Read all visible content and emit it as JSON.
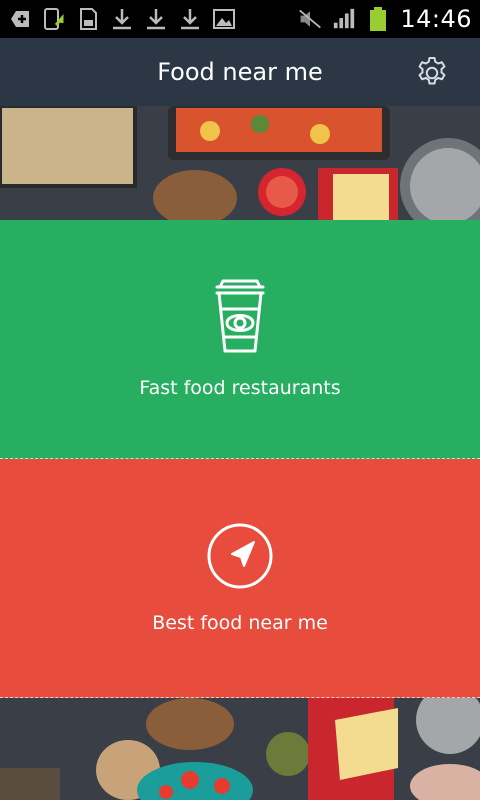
{
  "status_bar": {
    "time": "14:46",
    "icons": [
      "add-icon",
      "phone-update-icon",
      "sd-card-icon",
      "download-icon",
      "download-icon",
      "download-icon",
      "image-icon",
      "mute-icon",
      "signal-icon",
      "battery-icon"
    ]
  },
  "app_bar": {
    "title": "Food near me",
    "settings_icon": "gear-icon"
  },
  "tiles": [
    {
      "label": "Fast food restaurants",
      "icon": "coffee-cup-icon",
      "color": "#27ae60"
    },
    {
      "label": "Best food near me",
      "icon": "compass-navigation-icon",
      "color": "#e74c3c"
    }
  ],
  "colors": {
    "app_bar": "#2c3745",
    "status_bar": "#000000"
  }
}
